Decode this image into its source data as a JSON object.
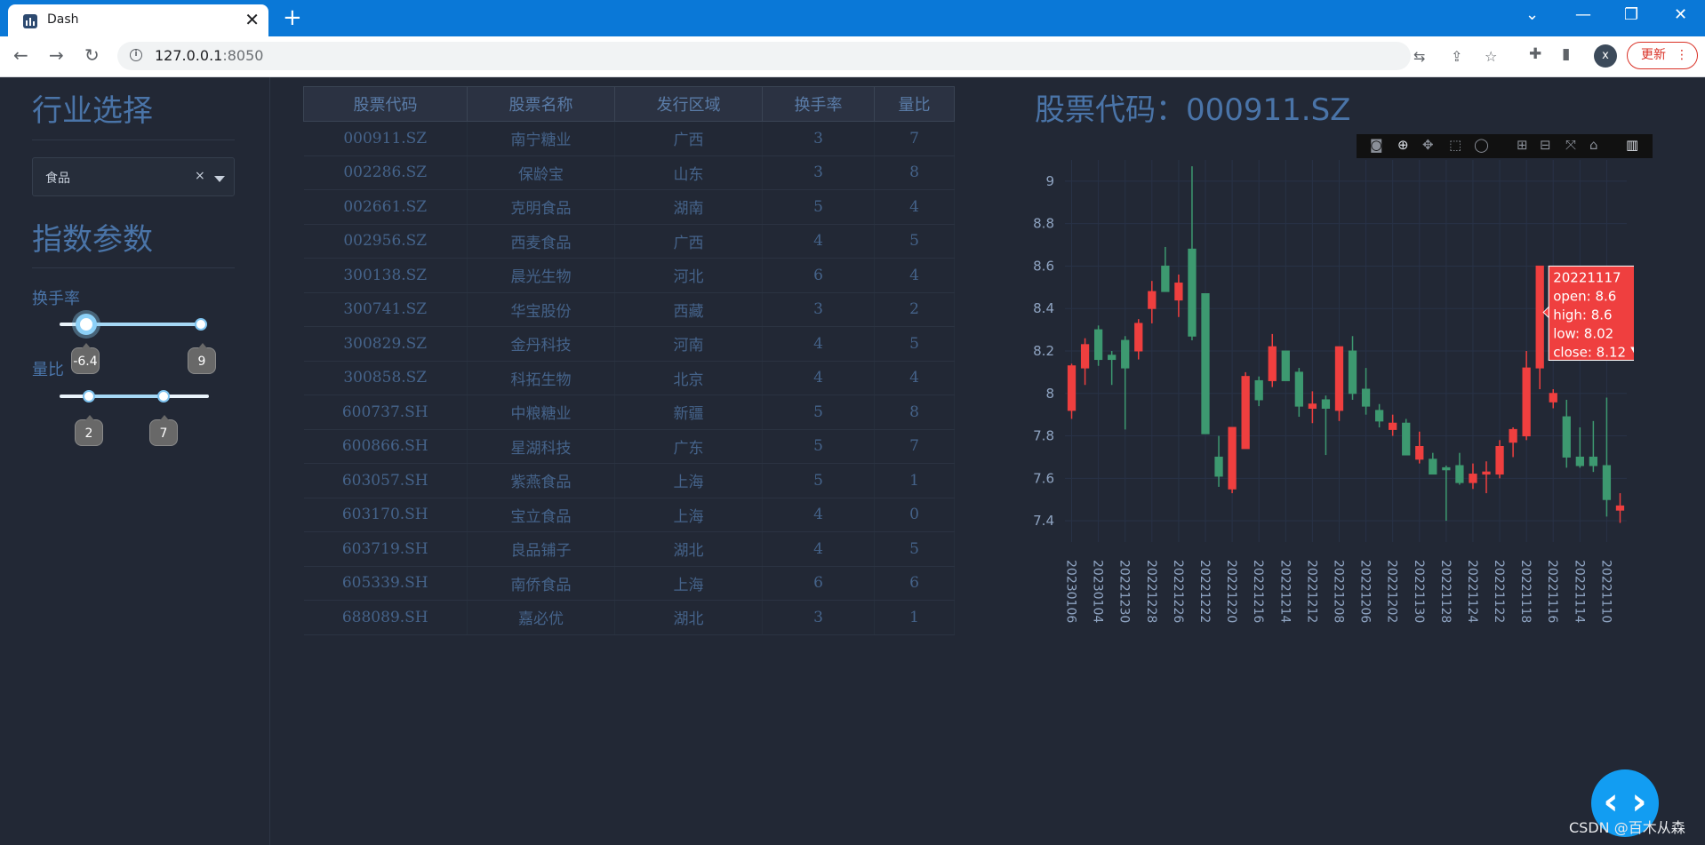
{
  "browser": {
    "tab_title": "Dash",
    "url_host": "127.0.0.1",
    "url_port": ":8050",
    "update_label": "更新",
    "profile_initial": "x"
  },
  "sidebar": {
    "industry_heading": "行业选择",
    "industry_value": "食品",
    "params_heading": "指数参数",
    "turnover_label": "换手率",
    "turnover_low": "-6.4",
    "turnover_high": "9",
    "volume_ratio_label": "量比",
    "volume_ratio_low": "2",
    "volume_ratio_high": "7"
  },
  "table": {
    "columns": [
      "股票代码",
      "股票名称",
      "发行区域",
      "换手率",
      "量比"
    ],
    "rows": [
      [
        "000911.SZ",
        "南宁糖业",
        "广西",
        "3",
        "7"
      ],
      [
        "002286.SZ",
        "保龄宝",
        "山东",
        "3",
        "8"
      ],
      [
        "002661.SZ",
        "克明食品",
        "湖南",
        "5",
        "4"
      ],
      [
        "002956.SZ",
        "西麦食品",
        "广西",
        "4",
        "5"
      ],
      [
        "300138.SZ",
        "晨光生物",
        "河北",
        "6",
        "4"
      ],
      [
        "300741.SZ",
        "华宝股份",
        "西藏",
        "3",
        "2"
      ],
      [
        "300829.SZ",
        "金丹科技",
        "河南",
        "4",
        "5"
      ],
      [
        "300858.SZ",
        "科拓生物",
        "北京",
        "4",
        "4"
      ],
      [
        "600737.SH",
        "中粮糖业",
        "新疆",
        "5",
        "8"
      ],
      [
        "600866.SH",
        "星湖科技",
        "广东",
        "5",
        "7"
      ],
      [
        "603057.SH",
        "紫燕食品",
        "上海",
        "5",
        "1"
      ],
      [
        "603170.SH",
        "宝立食品",
        "上海",
        "4",
        "0"
      ],
      [
        "603719.SH",
        "良品铺子",
        "湖北",
        "4",
        "5"
      ],
      [
        "605339.SH",
        "南侨食品",
        "上海",
        "6",
        "6"
      ],
      [
        "688089.SH",
        "嘉必优",
        "湖北",
        "3",
        "1"
      ]
    ]
  },
  "chart_title_prefix": "股票代码：",
  "chart_title_code": "000911.SZ",
  "watermark": "CSDN @百木从森",
  "colors": {
    "up": "#ef3f3f",
    "down": "#3d9970",
    "title": "#4a74a8"
  },
  "chart_data": {
    "type": "candlestick",
    "x_axis_reversed": true,
    "ylim": [
      7.3,
      9.1
    ],
    "yticks": [
      7.4,
      7.6,
      7.8,
      8,
      8.2,
      8.4,
      8.6,
      8.8,
      9
    ],
    "xtick_labels": [
      "20230106",
      "20230104",
      "20221230",
      "20221228",
      "20221226",
      "20221222",
      "20221220",
      "20221216",
      "20221214",
      "20221212",
      "20221208",
      "20221206",
      "20221202",
      "20221130",
      "20221128",
      "20221124",
      "20221122",
      "20221118",
      "20221116",
      "20221114",
      "20221110"
    ],
    "candles": [
      {
        "open": 7.92,
        "high": 8.14,
        "low": 7.88,
        "close": 8.13
      },
      {
        "open": 8.12,
        "high": 8.26,
        "low": 8.04,
        "close": 8.23
      },
      {
        "open": 8.3,
        "high": 8.32,
        "low": 8.13,
        "close": 8.16
      },
      {
        "open": 8.18,
        "high": 8.2,
        "low": 8.04,
        "close": 8.16
      },
      {
        "open": 8.25,
        "high": 8.27,
        "low": 7.83,
        "close": 8.12
      },
      {
        "open": 8.2,
        "high": 8.35,
        "low": 8.16,
        "close": 8.33
      },
      {
        "open": 8.4,
        "high": 8.53,
        "low": 8.33,
        "close": 8.48
      },
      {
        "open": 8.6,
        "high": 8.69,
        "low": 8.48,
        "close": 8.48
      },
      {
        "open": 8.44,
        "high": 8.56,
        "low": 8.36,
        "close": 8.52
      },
      {
        "open": 8.68,
        "high": 9.07,
        "low": 8.25,
        "close": 8.27
      },
      {
        "open": 8.47,
        "high": 8.47,
        "low": 7.82,
        "close": 7.81
      },
      {
        "open": 7.7,
        "high": 7.8,
        "low": 7.56,
        "close": 7.61
      },
      {
        "open": 7.55,
        "high": 7.84,
        "low": 7.53,
        "close": 7.84
      },
      {
        "open": 7.74,
        "high": 8.1,
        "low": 7.74,
        "close": 8.08
      },
      {
        "open": 8.06,
        "high": 8.08,
        "low": 7.94,
        "close": 7.97
      },
      {
        "open": 8.06,
        "high": 8.28,
        "low": 8.03,
        "close": 8.22
      },
      {
        "open": 8.2,
        "high": 8.2,
        "low": 8.06,
        "close": 8.06
      },
      {
        "open": 8.1,
        "high": 8.12,
        "low": 7.89,
        "close": 7.94
      },
      {
        "open": 7.93,
        "high": 8.01,
        "low": 7.86,
        "close": 7.95
      },
      {
        "open": 7.97,
        "high": 7.99,
        "low": 7.71,
        "close": 7.93
      },
      {
        "open": 7.92,
        "high": 8.22,
        "low": 7.87,
        "close": 8.22
      },
      {
        "open": 8.2,
        "high": 8.27,
        "low": 7.97,
        "close": 8.0
      },
      {
        "open": 8.02,
        "high": 8.12,
        "low": 7.9,
        "close": 7.94
      },
      {
        "open": 7.92,
        "high": 7.95,
        "low": 7.84,
        "close": 7.87
      },
      {
        "open": 7.83,
        "high": 7.9,
        "low": 7.8,
        "close": 7.86
      },
      {
        "open": 7.86,
        "high": 7.88,
        "low": 7.71,
        "close": 7.71
      },
      {
        "open": 7.69,
        "high": 7.82,
        "low": 7.67,
        "close": 7.75
      },
      {
        "open": 7.69,
        "high": 7.72,
        "low": 7.62,
        "close": 7.62
      },
      {
        "open": 7.65,
        "high": 7.66,
        "low": 7.4,
        "close": 7.64
      },
      {
        "open": 7.66,
        "high": 7.72,
        "low": 7.57,
        "close": 7.58
      },
      {
        "open": 7.58,
        "high": 7.67,
        "low": 7.55,
        "close": 7.62
      },
      {
        "open": 7.62,
        "high": 7.68,
        "low": 7.53,
        "close": 7.63
      },
      {
        "open": 7.62,
        "high": 7.78,
        "low": 7.6,
        "close": 7.75
      },
      {
        "open": 7.77,
        "high": 7.84,
        "low": 7.7,
        "close": 7.83
      },
      {
        "open": 7.8,
        "high": 8.2,
        "low": 7.78,
        "close": 8.12
      },
      {
        "open": 8.12,
        "high": 8.6,
        "low": 8.02,
        "close": 8.6
      },
      {
        "open": 7.96,
        "high": 8.02,
        "low": 7.93,
        "close": 8.0
      },
      {
        "open": 7.89,
        "high": 7.97,
        "low": 7.65,
        "close": 7.7
      },
      {
        "open": 7.7,
        "high": 7.84,
        "low": 7.65,
        "close": 7.66
      },
      {
        "open": 7.7,
        "high": 7.87,
        "low": 7.63,
        "close": 7.66
      },
      {
        "open": 7.66,
        "high": 7.98,
        "low": 7.42,
        "close": 7.5
      },
      {
        "open": 7.45,
        "high": 7.53,
        "low": 7.39,
        "close": 7.47
      }
    ],
    "hover": {
      "candle_index": 35,
      "lines": [
        "20221117",
        "open: 8.6",
        "high: 8.6",
        "low: 8.02",
        "close: 8.12"
      ]
    }
  }
}
